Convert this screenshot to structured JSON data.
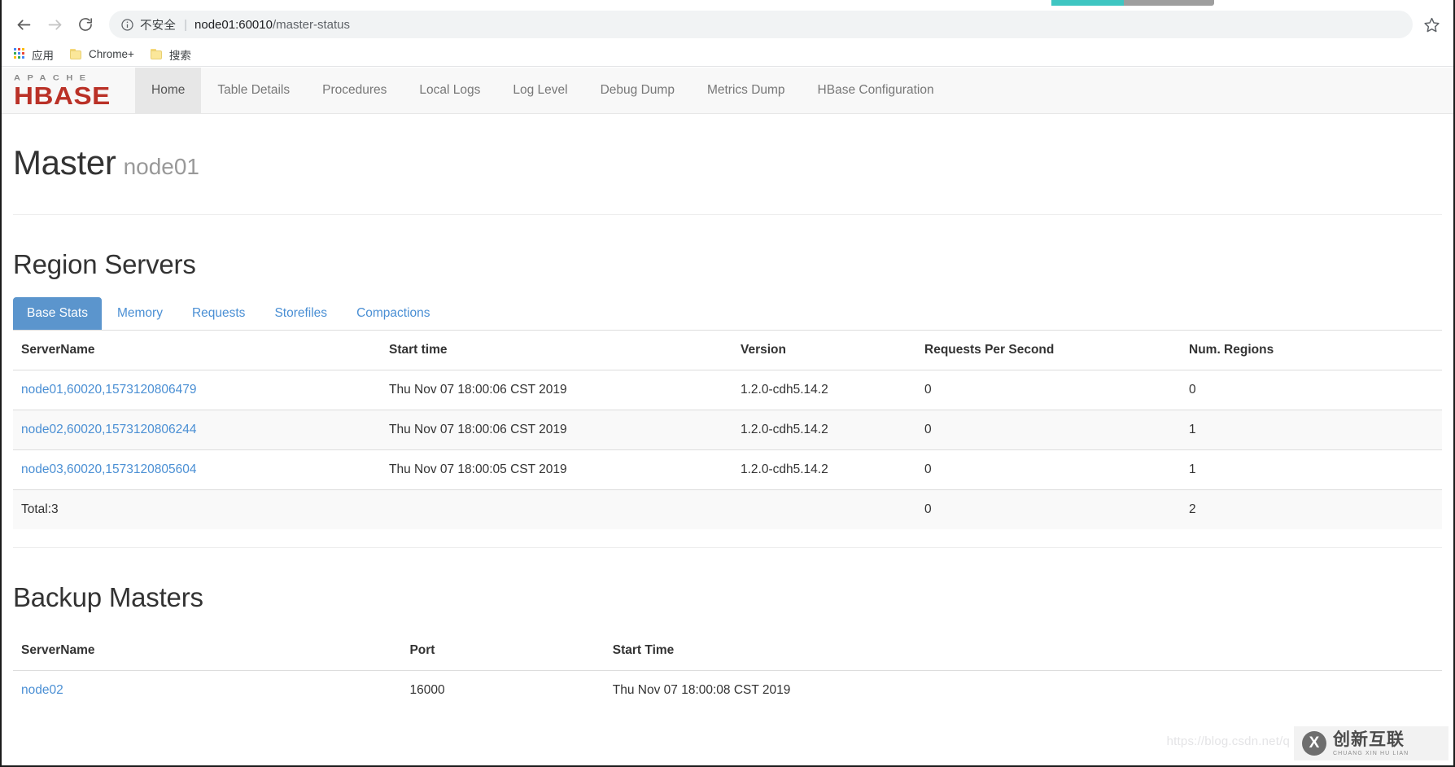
{
  "browser": {
    "back_label": "Back",
    "forward_label": "Forward",
    "reload_label": "Reload",
    "security_text": "不安全",
    "security_divider": "|",
    "url_host": "node01:60010",
    "url_path": "/master-status",
    "bookmark_star_label": "Bookmark this tab",
    "bookmarks": [
      {
        "label": "应用",
        "icon": "apps-grid-icon"
      },
      {
        "label": "Chrome+",
        "icon": "folder-icon"
      },
      {
        "label": "搜索",
        "icon": "folder-icon"
      }
    ]
  },
  "navbar": {
    "logo_top": "APACHE",
    "logo_bottom": "HBASE",
    "items": [
      {
        "label": "Home",
        "active": true
      },
      {
        "label": "Table Details",
        "active": false
      },
      {
        "label": "Procedures",
        "active": false
      },
      {
        "label": "Local Logs",
        "active": false
      },
      {
        "label": "Log Level",
        "active": false
      },
      {
        "label": "Debug Dump",
        "active": false
      },
      {
        "label": "Metrics Dump",
        "active": false
      },
      {
        "label": "HBase Configuration",
        "active": false
      }
    ]
  },
  "page": {
    "title": "Master",
    "title_sub": "node01"
  },
  "region_servers": {
    "heading": "Region Servers",
    "tabs": [
      {
        "label": "Base Stats",
        "active": true
      },
      {
        "label": "Memory",
        "active": false
      },
      {
        "label": "Requests",
        "active": false
      },
      {
        "label": "Storefiles",
        "active": false
      },
      {
        "label": "Compactions",
        "active": false
      }
    ],
    "columns": [
      "ServerName",
      "Start time",
      "Version",
      "Requests Per Second",
      "Num. Regions"
    ],
    "rows": [
      {
        "server_name": "node01,60020,1573120806479",
        "start_time": "Thu Nov 07 18:00:06 CST 2019",
        "version": "1.2.0-cdh5.14.2",
        "requests_per_second": "0",
        "num_regions": "0"
      },
      {
        "server_name": "node02,60020,1573120806244",
        "start_time": "Thu Nov 07 18:00:06 CST 2019",
        "version": "1.2.0-cdh5.14.2",
        "requests_per_second": "0",
        "num_regions": "1"
      },
      {
        "server_name": "node03,60020,1573120805604",
        "start_time": "Thu Nov 07 18:00:05 CST 2019",
        "version": "1.2.0-cdh5.14.2",
        "requests_per_second": "0",
        "num_regions": "1"
      }
    ],
    "total": {
      "label": "Total:3",
      "start_time": "",
      "version": "",
      "requests_per_second": "0",
      "num_regions": "2"
    }
  },
  "backup_masters": {
    "heading": "Backup Masters",
    "columns": [
      "ServerName",
      "Port",
      "Start Time"
    ],
    "rows": [
      {
        "server_name": "node02",
        "port": "16000",
        "start_time": "Thu Nov 07 18:00:08 CST 2019"
      }
    ]
  },
  "watermark": {
    "url_text": "https://blog.csdn.net/q",
    "badge_mark": "X",
    "badge_cn": "创新互联",
    "badge_en": "CHUANG XIN HU LIAN"
  },
  "colors": {
    "accent_blue": "#5b95cd",
    "link_blue": "#4a8fd4",
    "logo_red": "#ba3127",
    "nav_bg": "#f8f8f8"
  }
}
